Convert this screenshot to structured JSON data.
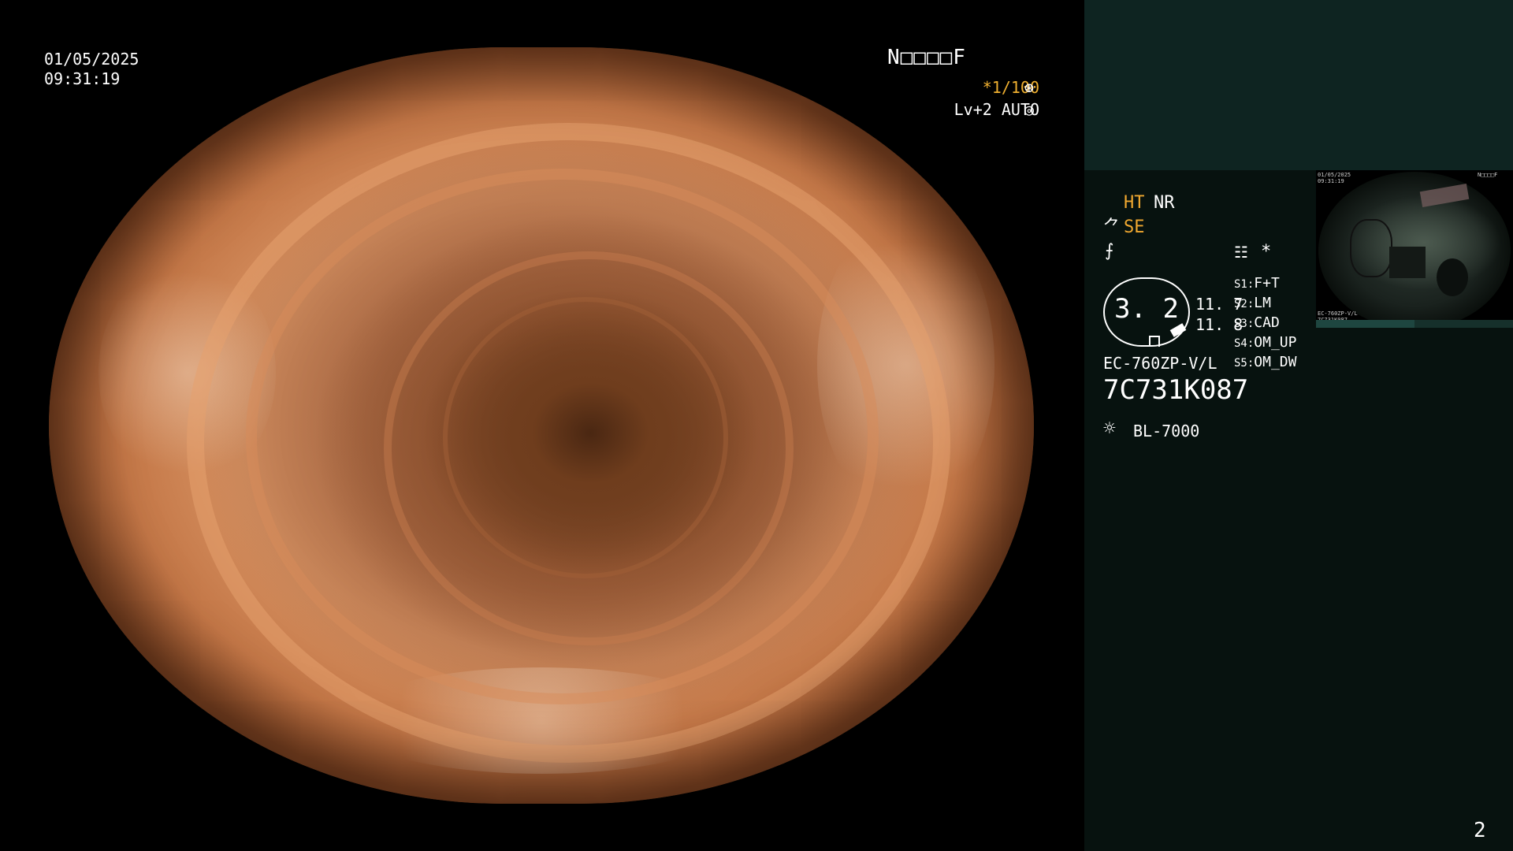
{
  "overlay": {
    "date": "01/05/2025",
    "time": "09:31:19",
    "patient_code": "N□□□□F",
    "shutter": "*1/100",
    "shutter_icon": "⊛",
    "level": "Lv+2 AUTO",
    "level_icon": "◎"
  },
  "panel": {
    "ht": "HT",
    "nr": "NR",
    "se": "SE",
    "se_icon": "⺈",
    "f_icon": "⨍",
    "menu_icon": "☷",
    "star": "*",
    "zoom": "3. 2",
    "values": [
      "11. 7",
      "11. 8"
    ],
    "switches": [
      {
        "key": "S1",
        "value": "F+T"
      },
      {
        "key": "S2",
        "value": "LM"
      },
      {
        "key": "S3",
        "value": "CAD"
      },
      {
        "key": "S4",
        "value": "OM_UP"
      },
      {
        "key": "S5",
        "value": "OM_DW"
      }
    ],
    "model": "EC-760ZP-V/L",
    "serial": "7C731K087",
    "light_icon": "☼",
    "light_source": "BL-7000",
    "page_number": "2"
  },
  "thumbnail": {
    "date": "01/05/2025",
    "time": "09:31:19",
    "patient_code": "N□□□□F",
    "model": "EC-760ZP-V/L",
    "serial": "7C731K087"
  },
  "colors": {
    "accent_orange": "#f0a830",
    "panel_background": "#07120f",
    "panel_top_background": "#0e2421"
  }
}
